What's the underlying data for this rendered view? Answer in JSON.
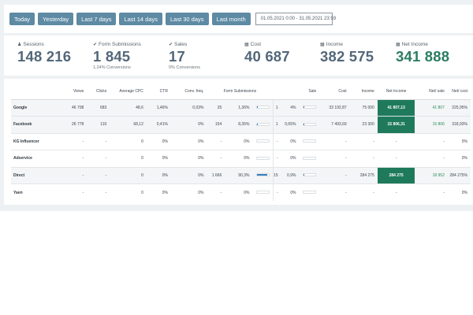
{
  "toolbar": {
    "buttons": [
      "Today",
      "Yesterday",
      "Last 7 days",
      "Last 14 days",
      "Last 30 days",
      "Last month"
    ],
    "date_range": "01.05.2021 0:00 - 31.05.2021 23:59"
  },
  "stats": [
    {
      "label": "Sessions",
      "value": "148 216",
      "sub": "",
      "icon": "users-icon"
    },
    {
      "label": "Form Submissions",
      "value": "1 845",
      "sub": "1,24% Conversions",
      "icon": "check-circle-icon"
    },
    {
      "label": "Sales",
      "value": "17",
      "sub": "0% Conversions",
      "icon": "check-circle-icon"
    },
    {
      "label": "Cost",
      "value": "40 687",
      "sub": "",
      "icon": "money-icon"
    },
    {
      "label": "Income",
      "value": "382 575",
      "sub": "",
      "icon": "money-icon"
    },
    {
      "label": "Net Income",
      "value": "341 888",
      "sub": "",
      "icon": "money-icon"
    }
  ],
  "colors": {
    "accent_button": "#5e8aa4",
    "net_income_value": "#2b7e60",
    "highlight_cell": "#1f7a5c",
    "progress_fill": "#3b7fc4"
  },
  "table": {
    "headers": {
      "views": "Views",
      "clicks": "Clicks",
      "avg_cpc": "Average CPC",
      "ctr": "CTR",
      "conv_freq": "Conv. freq.",
      "form_submissions": "Form Submissions",
      "sale": "Sale",
      "cost": "Cost",
      "income": "Income",
      "net_income": "Net Income",
      "net_sale": "Net/ sale",
      "net_cost": "Net/ cost"
    },
    "rows": [
      {
        "source": "Google",
        "views": "46 708",
        "clicks": "683",
        "avg_cpc": "48,6",
        "ctr": "1,46%",
        "conv_freq": "0,03%",
        "fs_count": "25",
        "fs_pct": "1,36%",
        "fs_fill": 0.0136,
        "sale_count": "1",
        "sale_pct": "4%",
        "sale_fill": 0.04,
        "cost": "33 192,87",
        "income": "75 000",
        "net_income": "41 807,13",
        "net_sale": "41 807",
        "net_cost": "225,95%"
      },
      {
        "source": "Facebook",
        "views": "26 778",
        "clicks": "110",
        "avg_cpc": "68,12",
        "ctr": "0,41%",
        "conv_freq": "0%",
        "fs_count": "154",
        "fs_pct": "8,35%",
        "fs_fill": 0.0835,
        "sale_count": "1",
        "sale_pct": "0,65%",
        "sale_fill": 0.0065,
        "cost": "7 493,69",
        "income": "23 300",
        "net_income": "15 806,31",
        "net_sale": "15 806",
        "net_cost": "318,93%"
      },
      {
        "source": "KG Influencer",
        "views": "-",
        "clicks": "-",
        "avg_cpc": "0",
        "ctr": "0%",
        "conv_freq": "0%",
        "fs_count": "-",
        "fs_pct": "0%",
        "fs_fill": 0,
        "sale_count": "-",
        "sale_pct": "0%",
        "sale_fill": 0,
        "cost": "-",
        "income": "-",
        "net_income": "-",
        "net_sale": "-",
        "net_cost": "0%"
      },
      {
        "source": "Adservice",
        "views": "-",
        "clicks": "-",
        "avg_cpc": "0",
        "ctr": "0%",
        "conv_freq": "0%",
        "fs_count": "-",
        "fs_pct": "0%",
        "fs_fill": 0,
        "sale_count": "-",
        "sale_pct": "0%",
        "sale_fill": 0,
        "cost": "-",
        "income": "-",
        "net_income": "-",
        "net_sale": "-",
        "net_cost": "0%"
      },
      {
        "source": "Direct",
        "views": "-",
        "clicks": "-",
        "avg_cpc": "0",
        "ctr": "0%",
        "conv_freq": "0%",
        "fs_count": "1 666",
        "fs_pct": "90,3%",
        "fs_fill": 0.903,
        "sale_count": "15",
        "sale_pct": "0,9%",
        "sale_fill": 0.009,
        "cost": "-",
        "income": "284 275",
        "net_income": "284 275",
        "net_sale": "18 952",
        "net_cost": "284 275%"
      },
      {
        "source": "Yaen",
        "views": "-",
        "clicks": "-",
        "avg_cpc": "0",
        "ctr": "0%",
        "conv_freq": "0%",
        "fs_count": "-",
        "fs_pct": "0%",
        "fs_fill": 0,
        "sale_count": "-",
        "sale_pct": "0%",
        "sale_fill": 0,
        "cost": "-",
        "income": "-",
        "net_income": "-",
        "net_sale": "-",
        "net_cost": "0%"
      }
    ]
  }
}
